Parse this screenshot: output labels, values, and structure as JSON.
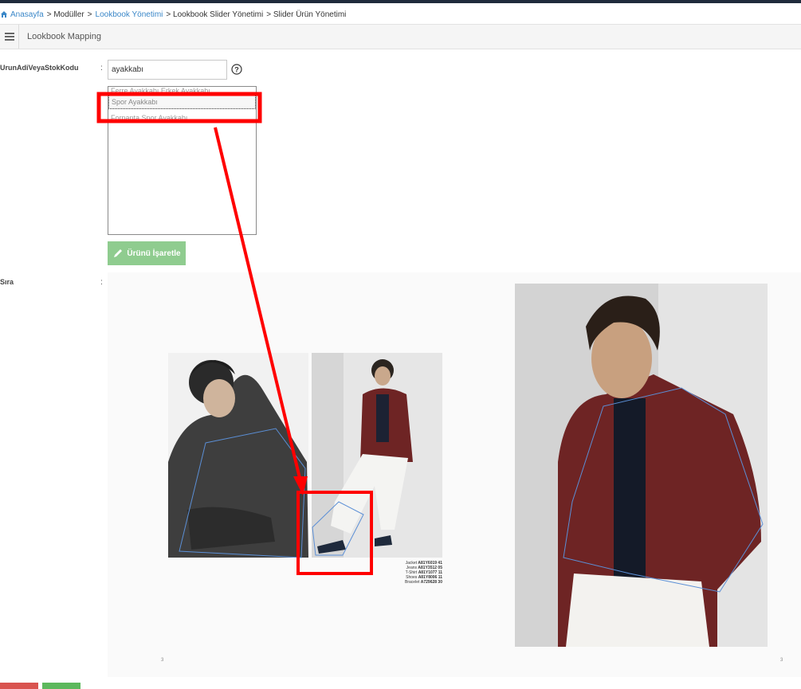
{
  "breadcrumb": {
    "home": "Anasayfa",
    "modules": "> Modüller",
    "lookbook_sep": ">",
    "lookbook": "Lookbook Yönetimi",
    "slider": "> Lookbook Slider Yönetimi",
    "product": "> Slider Ürün Yönetimi"
  },
  "panel": {
    "title": "Lookbook Mapping"
  },
  "form": {
    "search_label": "UrunAdiVeyaStokKodu",
    "colon": ":",
    "search_value": "ayakkabı",
    "results": [
      "Ferre Ayakkabı Erkek Ayakkabı",
      "Spor Ayakkabı",
      "Forpanta Spor Ayakkabı"
    ],
    "selected_index": 1,
    "mark_button": "Ürünü İşaretle",
    "order_label": "Sıra"
  },
  "lookbook": {
    "page_left": "3",
    "page_right": "3",
    "stock_codes": [
      {
        "label": "Jacket",
        "code": "A81Y6019 41"
      },
      {
        "label": "Jeans",
        "code": "A81Y3512 05"
      },
      {
        "label": "T-Shirt",
        "code": "A81Y1077 11"
      },
      {
        "label": "Shoes",
        "code": "A81Y8006 11"
      },
      {
        "label": "Bracelet",
        "code": "A729628 30"
      }
    ]
  },
  "colors": {
    "accent_link": "#3a87c8",
    "mark_button": "#8fcc8f",
    "annotation_red": "#ff0000",
    "hotspot_blue": "#5b8fd6",
    "jacket_burgundy": "#6e2424"
  },
  "icons": [
    "home-icon",
    "menu-icon",
    "help-icon",
    "pencil-icon"
  ]
}
